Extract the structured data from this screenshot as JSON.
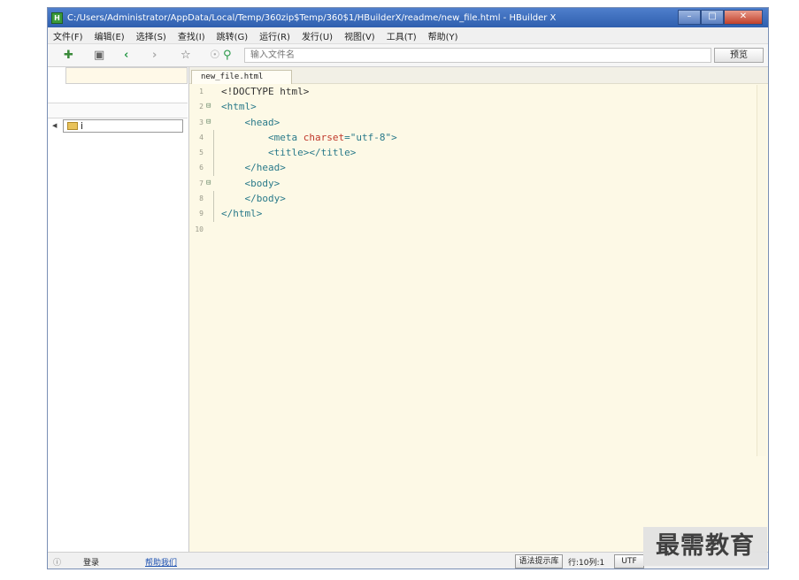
{
  "window": {
    "title": "C:/Users/Administrator/AppData/Local/Temp/360zip$Temp/360$1/HBuilderX/readme/new_file.html - HBuilder X",
    "app_icon": "H"
  },
  "menu": [
    "文件(F)",
    "编辑(E)",
    "选择(S)",
    "查找(I)",
    "跳转(G)",
    "运行(R)",
    "发行(U)",
    "视图(V)",
    "工具(T)",
    "帮助(Y)"
  ],
  "toolbar": {
    "search_placeholder": "输入文件名",
    "preview_label": "预览"
  },
  "explorer": {
    "tree_item": "i"
  },
  "editor": {
    "tab_label": "new_file.html",
    "lines": [
      {
        "n": "1",
        "fold": "",
        "segments": [
          {
            "t": "<!DOCTYPE html>",
            "c": "doctype"
          }
        ]
      },
      {
        "n": "2",
        "fold": "⊟",
        "segments": [
          {
            "t": "<html>",
            "c": "tag"
          }
        ]
      },
      {
        "n": "3",
        "fold": "⊟",
        "segments": [
          {
            "t": "    <head>",
            "c": "tag"
          }
        ]
      },
      {
        "n": "4",
        "fold": "",
        "segments": [
          {
            "t": "        <meta ",
            "c": "tag"
          },
          {
            "t": "charset",
            "c": "attr"
          },
          {
            "t": "=",
            "c": "tag"
          },
          {
            "t": "\"utf-8\"",
            "c": "str"
          },
          {
            "t": ">",
            "c": "tag"
          }
        ]
      },
      {
        "n": "5",
        "fold": "",
        "segments": [
          {
            "t": "        <title></title>",
            "c": "tag"
          }
        ]
      },
      {
        "n": "6",
        "fold": "",
        "segments": [
          {
            "t": "    </head>",
            "c": "tag"
          }
        ]
      },
      {
        "n": "7",
        "fold": "⊟",
        "segments": [
          {
            "t": "    <body>",
            "c": "tag"
          }
        ]
      },
      {
        "n": "8",
        "fold": "",
        "segments": [
          {
            "t": "    </body>",
            "c": "tag"
          }
        ]
      },
      {
        "n": "9",
        "fold": "",
        "segments": [
          {
            "t": "</html>",
            "c": "tag"
          }
        ]
      },
      {
        "n": "10",
        "fold": "",
        "segments": []
      }
    ]
  },
  "status": {
    "login": "登录",
    "help_link": "帮助我们",
    "syntax_btn": "语法提示库",
    "position": "行:10列:1",
    "encoding": "UTF"
  },
  "watermark": "最需教育"
}
